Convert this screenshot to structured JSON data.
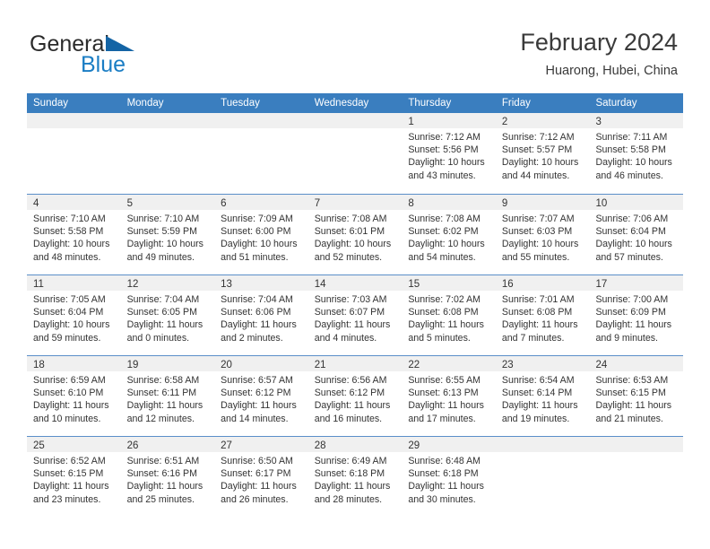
{
  "brand": {
    "word1": "General",
    "word2": "Blue",
    "triangle_color": "#1464a5",
    "blue_color": "#1a7dc4"
  },
  "header": {
    "title": "February 2024",
    "subtitle": "Huarong, Hubei, China"
  },
  "calendar": {
    "header_bg": "#3a7ebf",
    "daynum_bg": "#f0f0f0",
    "row_border": "#5b8fc9",
    "weekdays": [
      "Sunday",
      "Monday",
      "Tuesday",
      "Wednesday",
      "Thursday",
      "Friday",
      "Saturday"
    ],
    "weeks": [
      [
        {
          "day": "",
          "lines": []
        },
        {
          "day": "",
          "lines": []
        },
        {
          "day": "",
          "lines": []
        },
        {
          "day": "",
          "lines": []
        },
        {
          "day": "1",
          "lines": [
            "Sunrise: 7:12 AM",
            "Sunset: 5:56 PM",
            "Daylight: 10 hours",
            "and 43 minutes."
          ]
        },
        {
          "day": "2",
          "lines": [
            "Sunrise: 7:12 AM",
            "Sunset: 5:57 PM",
            "Daylight: 10 hours",
            "and 44 minutes."
          ]
        },
        {
          "day": "3",
          "lines": [
            "Sunrise: 7:11 AM",
            "Sunset: 5:58 PM",
            "Daylight: 10 hours",
            "and 46 minutes."
          ]
        }
      ],
      [
        {
          "day": "4",
          "lines": [
            "Sunrise: 7:10 AM",
            "Sunset: 5:58 PM",
            "Daylight: 10 hours",
            "and 48 minutes."
          ]
        },
        {
          "day": "5",
          "lines": [
            "Sunrise: 7:10 AM",
            "Sunset: 5:59 PM",
            "Daylight: 10 hours",
            "and 49 minutes."
          ]
        },
        {
          "day": "6",
          "lines": [
            "Sunrise: 7:09 AM",
            "Sunset: 6:00 PM",
            "Daylight: 10 hours",
            "and 51 minutes."
          ]
        },
        {
          "day": "7",
          "lines": [
            "Sunrise: 7:08 AM",
            "Sunset: 6:01 PM",
            "Daylight: 10 hours",
            "and 52 minutes."
          ]
        },
        {
          "day": "8",
          "lines": [
            "Sunrise: 7:08 AM",
            "Sunset: 6:02 PM",
            "Daylight: 10 hours",
            "and 54 minutes."
          ]
        },
        {
          "day": "9",
          "lines": [
            "Sunrise: 7:07 AM",
            "Sunset: 6:03 PM",
            "Daylight: 10 hours",
            "and 55 minutes."
          ]
        },
        {
          "day": "10",
          "lines": [
            "Sunrise: 7:06 AM",
            "Sunset: 6:04 PM",
            "Daylight: 10 hours",
            "and 57 minutes."
          ]
        }
      ],
      [
        {
          "day": "11",
          "lines": [
            "Sunrise: 7:05 AM",
            "Sunset: 6:04 PM",
            "Daylight: 10 hours",
            "and 59 minutes."
          ]
        },
        {
          "day": "12",
          "lines": [
            "Sunrise: 7:04 AM",
            "Sunset: 6:05 PM",
            "Daylight: 11 hours",
            "and 0 minutes."
          ]
        },
        {
          "day": "13",
          "lines": [
            "Sunrise: 7:04 AM",
            "Sunset: 6:06 PM",
            "Daylight: 11 hours",
            "and 2 minutes."
          ]
        },
        {
          "day": "14",
          "lines": [
            "Sunrise: 7:03 AM",
            "Sunset: 6:07 PM",
            "Daylight: 11 hours",
            "and 4 minutes."
          ]
        },
        {
          "day": "15",
          "lines": [
            "Sunrise: 7:02 AM",
            "Sunset: 6:08 PM",
            "Daylight: 11 hours",
            "and 5 minutes."
          ]
        },
        {
          "day": "16",
          "lines": [
            "Sunrise: 7:01 AM",
            "Sunset: 6:08 PM",
            "Daylight: 11 hours",
            "and 7 minutes."
          ]
        },
        {
          "day": "17",
          "lines": [
            "Sunrise: 7:00 AM",
            "Sunset: 6:09 PM",
            "Daylight: 11 hours",
            "and 9 minutes."
          ]
        }
      ],
      [
        {
          "day": "18",
          "lines": [
            "Sunrise: 6:59 AM",
            "Sunset: 6:10 PM",
            "Daylight: 11 hours",
            "and 10 minutes."
          ]
        },
        {
          "day": "19",
          "lines": [
            "Sunrise: 6:58 AM",
            "Sunset: 6:11 PM",
            "Daylight: 11 hours",
            "and 12 minutes."
          ]
        },
        {
          "day": "20",
          "lines": [
            "Sunrise: 6:57 AM",
            "Sunset: 6:12 PM",
            "Daylight: 11 hours",
            "and 14 minutes."
          ]
        },
        {
          "day": "21",
          "lines": [
            "Sunrise: 6:56 AM",
            "Sunset: 6:12 PM",
            "Daylight: 11 hours",
            "and 16 minutes."
          ]
        },
        {
          "day": "22",
          "lines": [
            "Sunrise: 6:55 AM",
            "Sunset: 6:13 PM",
            "Daylight: 11 hours",
            "and 17 minutes."
          ]
        },
        {
          "day": "23",
          "lines": [
            "Sunrise: 6:54 AM",
            "Sunset: 6:14 PM",
            "Daylight: 11 hours",
            "and 19 minutes."
          ]
        },
        {
          "day": "24",
          "lines": [
            "Sunrise: 6:53 AM",
            "Sunset: 6:15 PM",
            "Daylight: 11 hours",
            "and 21 minutes."
          ]
        }
      ],
      [
        {
          "day": "25",
          "lines": [
            "Sunrise: 6:52 AM",
            "Sunset: 6:15 PM",
            "Daylight: 11 hours",
            "and 23 minutes."
          ]
        },
        {
          "day": "26",
          "lines": [
            "Sunrise: 6:51 AM",
            "Sunset: 6:16 PM",
            "Daylight: 11 hours",
            "and 25 minutes."
          ]
        },
        {
          "day": "27",
          "lines": [
            "Sunrise: 6:50 AM",
            "Sunset: 6:17 PM",
            "Daylight: 11 hours",
            "and 26 minutes."
          ]
        },
        {
          "day": "28",
          "lines": [
            "Sunrise: 6:49 AM",
            "Sunset: 6:18 PM",
            "Daylight: 11 hours",
            "and 28 minutes."
          ]
        },
        {
          "day": "29",
          "lines": [
            "Sunrise: 6:48 AM",
            "Sunset: 6:18 PM",
            "Daylight: 11 hours",
            "and 30 minutes."
          ]
        },
        {
          "day": "",
          "lines": []
        },
        {
          "day": "",
          "lines": []
        }
      ]
    ]
  }
}
